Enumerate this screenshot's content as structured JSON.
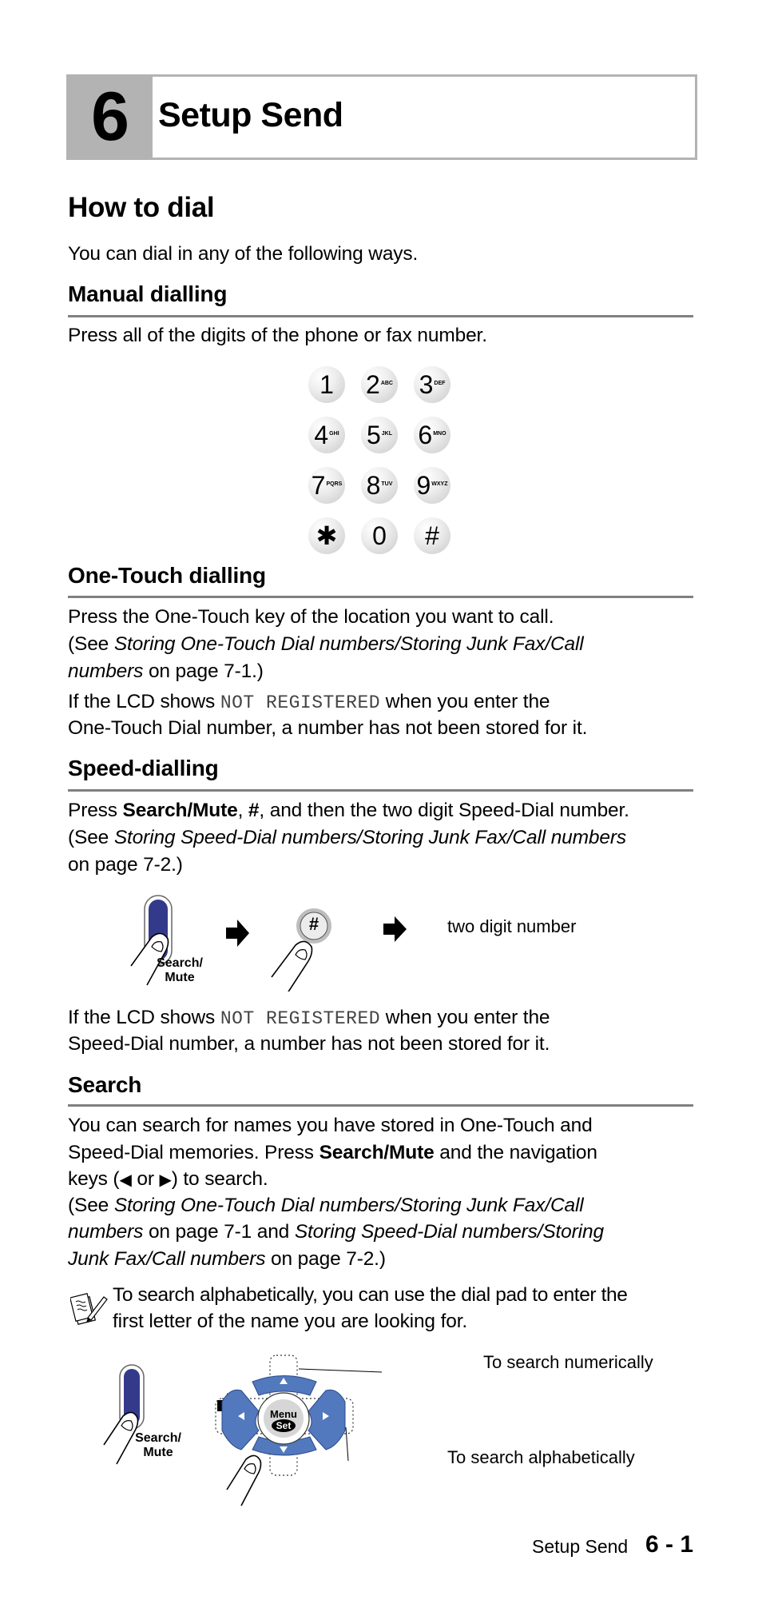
{
  "chapter": {
    "number": "6",
    "title": "Setup Send"
  },
  "section": {
    "title": "How to dial",
    "intro": "You can dial in any of the following ways."
  },
  "manual": {
    "heading": "Manual dialling",
    "text": "Press all of the digits of the phone or fax number.",
    "keypad": [
      {
        "digit": "1",
        "letters": ""
      },
      {
        "digit": "2",
        "letters": "ABC"
      },
      {
        "digit": "3",
        "letters": "DEF"
      },
      {
        "digit": "4",
        "letters": "GHI"
      },
      {
        "digit": "5",
        "letters": "JKL"
      },
      {
        "digit": "6",
        "letters": "MNO"
      },
      {
        "digit": "7",
        "letters": "PQRS"
      },
      {
        "digit": "8",
        "letters": "TUV"
      },
      {
        "digit": "9",
        "letters": "WXYZ"
      },
      {
        "digit": "✱",
        "letters": ""
      },
      {
        "digit": "0",
        "letters": ""
      },
      {
        "digit": "#",
        "letters": ""
      }
    ]
  },
  "onetouch": {
    "heading": "One-Touch dialling",
    "line1": "Press the One-Touch key of the location you want to call.",
    "see_prefix": "(See ",
    "see_ref": "Storing One-Touch Dial numbers/Storing Junk Fax/Call",
    "see_ref2": "numbers",
    "see_suffix": " on page 7-1.)",
    "lcd_prefix": "If the LCD shows ",
    "lcd_value": "NOT REGISTERED",
    "lcd_suffix": " when you enter the",
    "lcd_line2": "One-Touch Dial number, a number has not been stored for it."
  },
  "speed": {
    "heading": "Speed-dialling",
    "press": "Press ",
    "key1": "Search/Mute",
    "comma": ", ",
    "key2": "#",
    "rest": ", and then the two digit Speed-Dial number.",
    "see_prefix": "(See ",
    "see_ref": "Storing Speed-Dial numbers/Storing Junk Fax/Call numbers",
    "see_line2": "on page 7-2.)",
    "diagram": {
      "button_label_1": "Search/",
      "button_label_2": "Mute",
      "hash_key": "#",
      "final_label": "two digit number"
    },
    "lcd_prefix": "If the LCD shows ",
    "lcd_value": "NOT REGISTERED",
    "lcd_suffix": " when you enter the",
    "lcd_line2": "Speed-Dial number, a number has not been stored for it."
  },
  "search": {
    "heading": "Search",
    "line1": "You can search for names you have stored in One-Touch and",
    "line2_prefix": "Speed-Dial memories. Press ",
    "line2_key": "Search/Mute",
    "line2_suffix": " and the navigation",
    "line3_prefix": "keys (",
    "left_arrow": "◀",
    "or": " or ",
    "right_arrow": "▶",
    "line3_suffix": ") to search.",
    "see_prefix": "(See ",
    "see_ref1": "Storing One-Touch Dial numbers/Storing Junk Fax/Call",
    "see_ref1b": "numbers",
    "see_mid": " on page 7-1 and ",
    "see_ref2": "Storing Speed-Dial numbers/Storing",
    "see_ref2b": "Junk Fax/Call numbers",
    "see_suffix": " on page 7-2.)",
    "note_line1": "To search alphabetically, you can use the dial pad to enter the",
    "note_line2": "first letter of the name you are looking for.",
    "diagram": {
      "button_label_1": "Search/",
      "button_label_2": "Mute",
      "menu": "Menu",
      "set": "Set",
      "numeric_label": "To search numerically",
      "alpha_label": "To search alphabetically"
    }
  },
  "footer": {
    "label": "Setup Send",
    "page": "6 - 1"
  },
  "colors": {
    "nav_blue": "#5278bd",
    "search_key": "#343a8a",
    "rule": "#808080",
    "chapter_gray": "#b3b3b3"
  }
}
